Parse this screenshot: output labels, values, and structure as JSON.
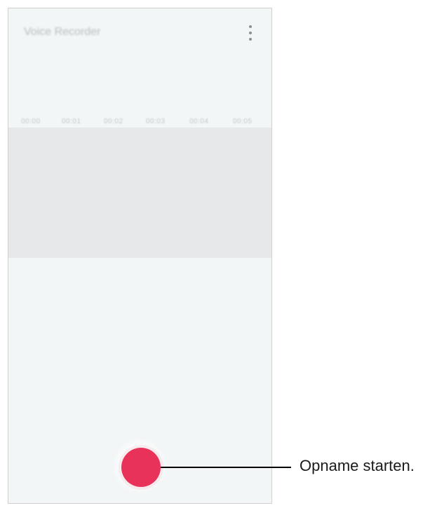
{
  "app": {
    "title": "Voice Recorder"
  },
  "topbar": {
    "more_icon": "more-options-icon"
  },
  "timeline": {
    "labels": [
      "00:00",
      "00:01",
      "00:02",
      "00:03",
      "00:04",
      "00:05"
    ]
  },
  "record": {
    "icon": "record-icon",
    "color": "#e8325a"
  },
  "callout": {
    "text": "Opname starten."
  }
}
